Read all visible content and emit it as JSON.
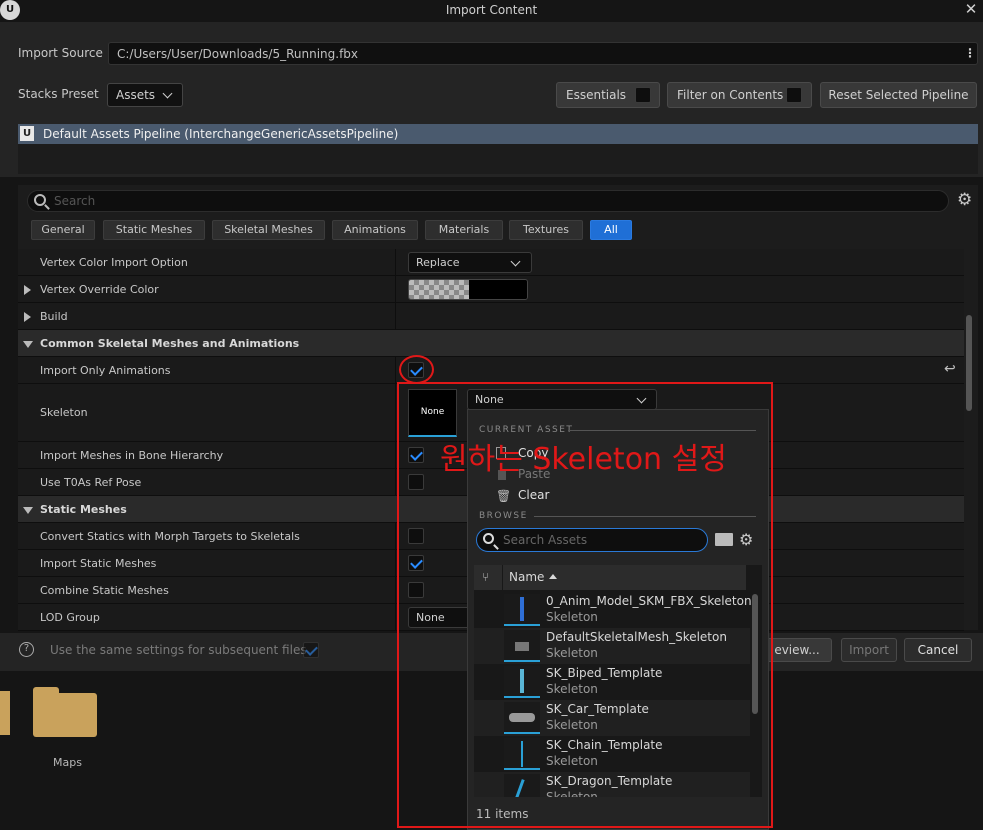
{
  "window": {
    "title": "Import Content",
    "logo": "ue-logo",
    "close_glyph": "✕"
  },
  "import_source": {
    "label": "Import Source",
    "value": "C:/Users/User/Downloads/5_Running.fbx"
  },
  "stacks_preset": {
    "label": "Stacks Preset",
    "value": "Assets"
  },
  "toolbar": {
    "essentials": "Essentials",
    "filter_on_contents": "Filter on Contents",
    "reset_selected_pipeline": "Reset Selected Pipeline"
  },
  "pipeline": {
    "label": "Default Assets Pipeline (InterchangeGenericAssetsPipeline)"
  },
  "search": {
    "placeholder": "Search"
  },
  "tabs": [
    "General",
    "Static Meshes",
    "Skeletal Meshes",
    "Animations",
    "Materials",
    "Textures",
    "All"
  ],
  "rows": {
    "vertex_color_import_option": {
      "label": "Vertex Color Import Option",
      "value": "Replace"
    },
    "vertex_override_color": {
      "label": "Vertex Override Color"
    },
    "build": {
      "label": "Build"
    },
    "common_section": {
      "label": "Common Skeletal Meshes and Animations"
    },
    "import_only_animations": {
      "label": "Import Only Animations",
      "checked": true
    },
    "skeleton": {
      "label": "Skeleton",
      "thumb_text": "None",
      "value": "None"
    },
    "import_meshes_in_bone_hierarchy": {
      "label": "Import Meshes in Bone Hierarchy",
      "checked": true
    },
    "use_t0_as_ref_pose": {
      "label": "Use T0As Ref Pose",
      "checked": false
    },
    "static_meshes_section": {
      "label": "Static Meshes"
    },
    "convert_statics": {
      "label": "Convert Statics with Morph Targets to Skeletals",
      "checked": false
    },
    "import_static_meshes": {
      "label": "Import Static Meshes",
      "checked": true
    },
    "combine_static_meshes": {
      "label": "Combine Static Meshes",
      "checked": false
    },
    "lod_group": {
      "label": "LOD Group",
      "value": "None"
    }
  },
  "bottom": {
    "same_settings_label": "Use the same settings for subsequent files",
    "preview_button": "eview...",
    "import_button": "Import",
    "cancel_button": "Cancel"
  },
  "content_browser": {
    "folder_label": "Maps"
  },
  "picker": {
    "current_asset_header": "CURRENT ASSET",
    "copy": "Copy",
    "paste": "Paste",
    "clear": "Clear",
    "browse_header": "BROWSE",
    "search_placeholder": "Search Assets",
    "column_name": "Name",
    "items": [
      {
        "name": "0_Anim_Model_SKM_FBX_Skeleton",
        "type": "Skeleton"
      },
      {
        "name": "DefaultSkeletalMesh_Skeleton",
        "type": "Skeleton"
      },
      {
        "name": "SK_Biped_Template",
        "type": "Skeleton"
      },
      {
        "name": "SK_Car_Template",
        "type": "Skeleton"
      },
      {
        "name": "SK_Chain_Template",
        "type": "Skeleton"
      },
      {
        "name": "SK_Dragon_Template",
        "type": "Skeleton"
      }
    ],
    "count": "11 items"
  },
  "annotation": {
    "text": "원하는 Skeleton 설정",
    "color": "#e01818"
  },
  "colors": {
    "accent": "#1f6fd6",
    "check": "#2a8cff",
    "annotation_red": "#e01818"
  }
}
